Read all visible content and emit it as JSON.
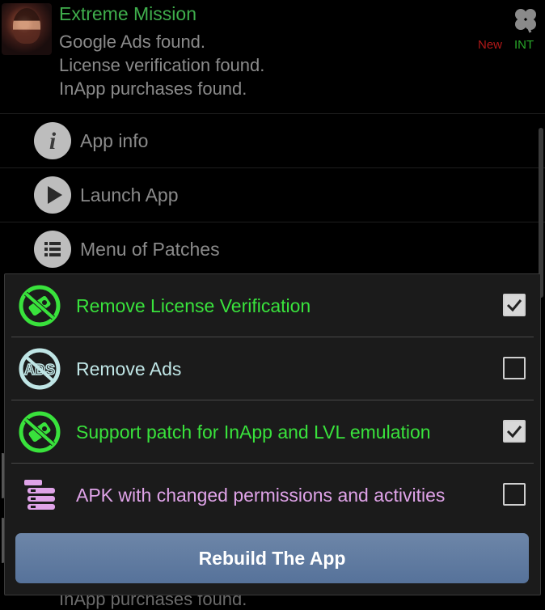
{
  "app": {
    "title": "Extreme Mission",
    "lines": [
      "Google Ads found.",
      "License verification found.",
      "InApp purchases found."
    ],
    "badge_new": "New",
    "badge_int": "INT"
  },
  "menu": {
    "items": [
      {
        "label": "App info",
        "icon": "info-icon"
      },
      {
        "label": "Launch App",
        "icon": "play-icon"
      },
      {
        "label": "Menu of Patches",
        "icon": "list-icon"
      }
    ]
  },
  "background": {
    "partial_text": "InApp purchases found."
  },
  "dialog": {
    "options": [
      {
        "label": "Remove License Verification",
        "checked": true,
        "color": "#39e23c",
        "icon": "no-license-icon"
      },
      {
        "label": "Remove Ads",
        "checked": false,
        "color": "#bfe5e5",
        "icon": "no-ads-icon"
      },
      {
        "label": "Support patch for InApp and LVL emulation",
        "checked": true,
        "color": "#39e23c",
        "icon": "inapp-lvl-icon"
      },
      {
        "label": "APK with changed permissions and activities",
        "checked": false,
        "color": "#dfa3e8",
        "icon": "permissions-list-icon"
      }
    ],
    "rebuild_label": "Rebuild The App"
  }
}
